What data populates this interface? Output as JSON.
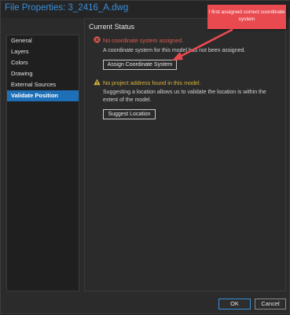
{
  "window": {
    "title": "File Properties: 3_2416_A.dwg"
  },
  "sidebar": {
    "items": [
      {
        "label": "General",
        "active": false
      },
      {
        "label": "Layers",
        "active": false
      },
      {
        "label": "Colors",
        "active": false
      },
      {
        "label": "Drawing",
        "active": false
      },
      {
        "label": "External Sources",
        "active": false
      },
      {
        "label": "Validate Position",
        "active": true
      }
    ]
  },
  "main": {
    "section_title": "Current Status",
    "coordinate": {
      "heading": "No coordinate system assigned.",
      "description": "A coordinate system for this model has not been assigned.",
      "button_label": "Assign Coordinate System"
    },
    "address": {
      "heading": "No project address found in this model.",
      "description": "Suggesting a location allows us to validate the location is within the extent of the model.",
      "button_label": "Suggest Location"
    }
  },
  "callout": {
    "text": "I first assigned correct coordinate system"
  },
  "footer": {
    "ok_label": "OK",
    "cancel_label": "Cancel"
  },
  "colors": {
    "accent": "#1d6fb8",
    "error": "#e05a4e",
    "warning": "#d9b43a",
    "callout": "#e84a4f"
  },
  "icons": {
    "error": "error-x-circle-icon",
    "warning": "warning-triangle-icon",
    "arrow": "annotation-arrow-icon"
  }
}
